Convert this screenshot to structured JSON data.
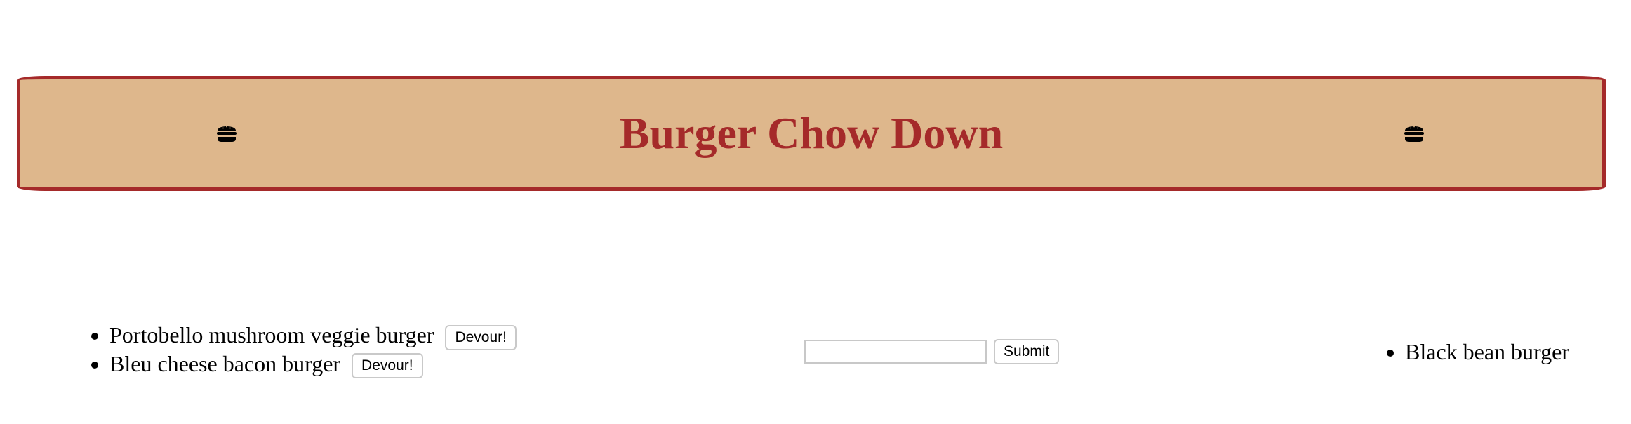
{
  "header": {
    "title": "Burger Chow Down",
    "left_icon": "burger-icon",
    "right_icon": "burger-icon",
    "title_color": "#A52A2A",
    "background_color": "#DEB78C",
    "border_color": "#A52A2A"
  },
  "to_devour": {
    "items": [
      {
        "name": "Portobello mushroom veggie burger",
        "button_label": "Devour!"
      },
      {
        "name": "Bleu cheese bacon burger",
        "button_label": "Devour!"
      }
    ]
  },
  "add_form": {
    "input_value": "",
    "submit_label": "Submit"
  },
  "devoured": {
    "items": [
      {
        "name": "Black bean burger"
      }
    ]
  }
}
